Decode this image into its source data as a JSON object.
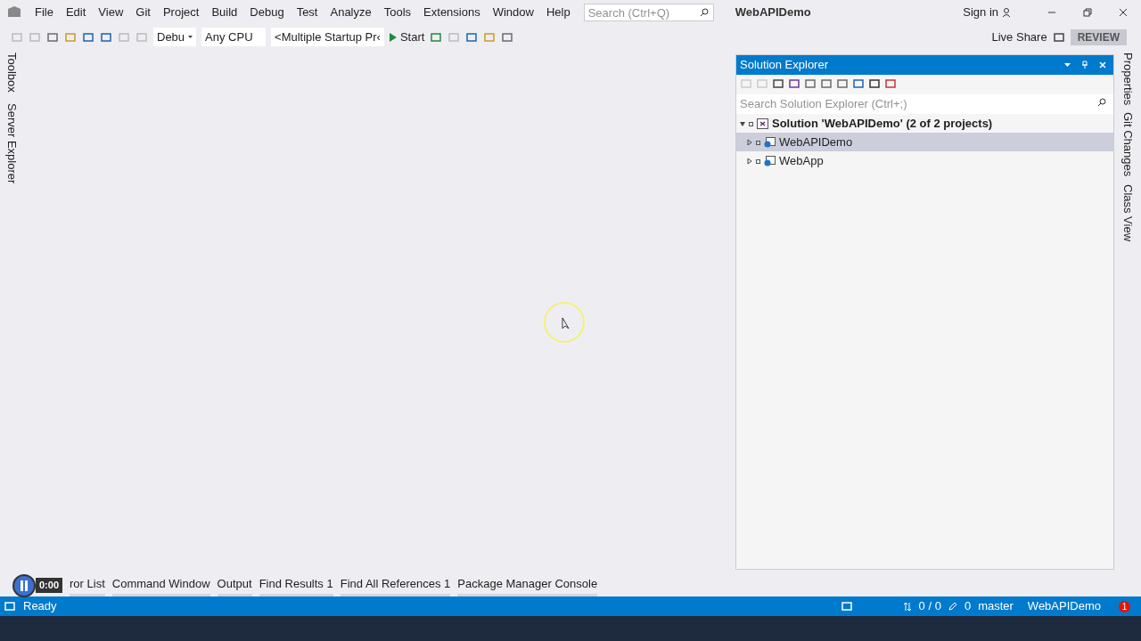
{
  "menu": [
    "File",
    "Edit",
    "View",
    "Git",
    "Project",
    "Build",
    "Debug",
    "Test",
    "Analyze",
    "Tools",
    "Extensions",
    "Window",
    "Help"
  ],
  "search": {
    "placeholder": "Search (Ctrl+Q)"
  },
  "window": {
    "title": "WebAPIDemo"
  },
  "sign_in": "Sign in",
  "toolbar": {
    "configuration": "Debu",
    "platform": "Any CPU",
    "startup": "<Multiple Startup Pr‹",
    "start": "Start",
    "live_share": "Live Share",
    "review": "REVIEW"
  },
  "left_tabs": [
    "Toolbox",
    "Server Explorer"
  ],
  "right_tabs": [
    "Properties",
    "Git Changes",
    "Class View"
  ],
  "solution_explorer": {
    "title": "Solution Explorer",
    "search": {
      "placeholder": "Search Solution Explorer (Ctrl+;)"
    },
    "tree": [
      {
        "label": "Solution 'WebAPIDemo' (2 of 2 projects)",
        "kind": "solution",
        "expanded": true,
        "selected": false,
        "children": [
          {
            "label": "WebAPIDemo",
            "kind": "project",
            "expanded": false,
            "selected": true
          },
          {
            "label": "WebApp",
            "kind": "project",
            "expanded": false,
            "selected": false
          }
        ]
      }
    ]
  },
  "bottom_tabs": [
    "ror List",
    "Command Window",
    "Output",
    "Find Results 1",
    "Find All References 1",
    "Package Manager Console"
  ],
  "player": {
    "time": "0:00"
  },
  "status_bar": {
    "text": "Ready",
    "sync": "0 / 0",
    "changes": "0",
    "branch": "master",
    "repo": "WebAPIDemo",
    "notifications": "1"
  }
}
